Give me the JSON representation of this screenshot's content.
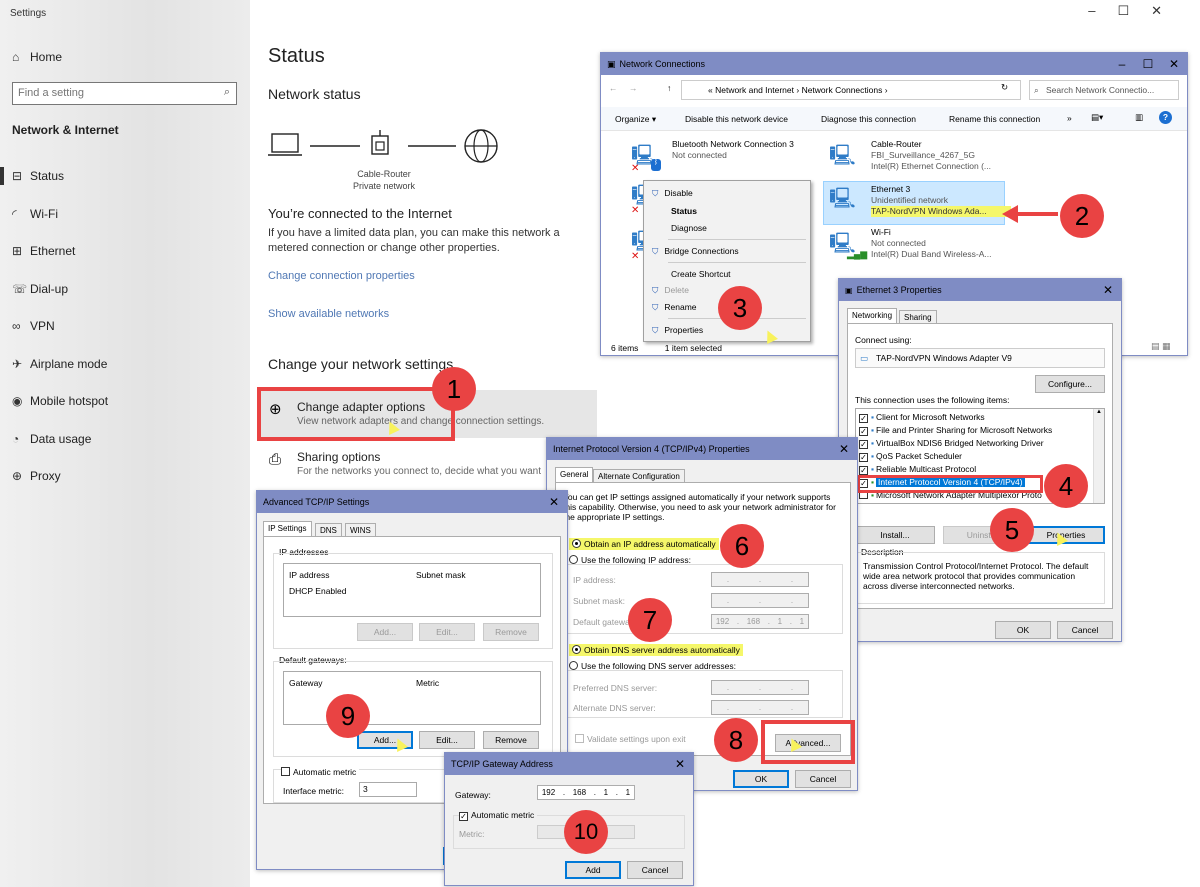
{
  "settings": {
    "window_title": "Settings",
    "home": "Home",
    "search_placeholder": "Find a setting",
    "section": "Network & Internet",
    "nav": [
      "Status",
      "Wi-Fi",
      "Ethernet",
      "Dial-up",
      "VPN",
      "Airplane mode",
      "Mobile hotspot",
      "Data usage",
      "Proxy"
    ],
    "status_title": "Status",
    "network_status": "Network status",
    "router_label": "Cable-Router",
    "network_label": "Private network",
    "connected_heading": "You’re connected to the Internet",
    "connected_text": "If you have a limited data plan, you can make this network a metered connection or change other properties.",
    "change_props_link": "Change connection properties",
    "show_networks_link": "Show available networks",
    "change_heading": "Change your network settings",
    "adapter_title": "Change adapter options",
    "adapter_desc": "View network adapters and change connection settings.",
    "sharing_title": "Sharing options",
    "sharing_desc": "For the networks you connect to, decide what you want"
  },
  "netconn": {
    "title": "Network Connections",
    "path": [
      "Network and Internet",
      "Network Connections"
    ],
    "search_placeholder": "Search Network Connectio...",
    "toolbar": [
      "Organize ▾",
      "Disable this network device",
      "Diagnose this connection",
      "Rename this connection",
      "»"
    ],
    "items": [
      {
        "name": "Bluetooth Network Connection 3",
        "line2": "Not connected",
        "line3": ""
      },
      {
        "name": "Cable-Router",
        "line2": "FBI_Surveillance_4267_5G",
        "line3": "Intel(R) Ethernet Connection (..."
      },
      {
        "name": "Ethernet 3",
        "line2": "Unidentified network",
        "line3": "TAP-NordVPN Windows Ada..."
      },
      {
        "name": "Wi-Fi",
        "line2": "Not connected",
        "line3": "Intel(R) Dual Band Wireless-A..."
      }
    ],
    "status_items": "6 items",
    "status_selected": "1 item selected"
  },
  "context_menu": [
    "Disable",
    "Status",
    "Diagnose",
    "Bridge Connections",
    "Create Shortcut",
    "Delete",
    "Rename",
    "Properties"
  ],
  "eth_props": {
    "title": "Ethernet 3 Properties",
    "tabs": [
      "Networking",
      "Sharing"
    ],
    "connect_using": "Connect using:",
    "adapter": "TAP-NordVPN Windows Adapter V9",
    "configure": "Configure...",
    "items_label": "This connection uses the following items:",
    "items": [
      "Client for Microsoft Networks",
      "File and Printer Sharing for Microsoft Networks",
      "VirtualBox NDIS6 Bridged Networking Driver",
      "QoS Packet Scheduler",
      "Reliable Multicast Protocol",
      "Internet Protocol Version 4 (TCP/IPv4)",
      "Microsoft Network Adapter Multiplexor Proto"
    ],
    "install": "Install...",
    "uninstall": "Uninstall",
    "properties": "Properties",
    "description_label": "Description",
    "description": "Transmission Control Protocol/Internet Protocol. The default wide area network protocol that provides communication across diverse interconnected networks.",
    "ok": "OK",
    "cancel": "Cancel"
  },
  "ipv4": {
    "title": "Internet Protocol Version 4 (TCP/IPv4) Properties",
    "tabs": [
      "General",
      "Alternate Configuration"
    ],
    "intro": "You can get IP settings assigned automatically if your network supports this capability. Otherwise, you need to ask your network administrator for the appropriate IP settings.",
    "auto_ip": "Obtain an IP address automatically",
    "manual_ip": "Use the following IP address:",
    "ip_label": "IP address:",
    "mask_label": "Subnet mask:",
    "gw_label": "Default gateway:",
    "gw_value": [
      "192",
      "168",
      "1",
      "1"
    ],
    "auto_dns": "Obtain DNS server address automatically",
    "manual_dns": "Use the following DNS server addresses:",
    "pref_dns": "Preferred DNS server:",
    "alt_dns": "Alternate DNS server:",
    "validate": "Validate settings upon exit",
    "advanced": "Advanced...",
    "ok": "OK",
    "cancel": "Cancel"
  },
  "adv": {
    "title": "Advanced TCP/IP Settings",
    "tabs": [
      "IP Settings",
      "DNS",
      "WINS"
    ],
    "ip_addresses": "IP addresses",
    "col_ip": "IP address",
    "col_mask": "Subnet mask",
    "dhcp": "DHCP Enabled",
    "add": "Add...",
    "edit": "Edit...",
    "remove": "Remove",
    "gateways": "Default gateways:",
    "col_gw": "Gateway",
    "col_metric": "Metric",
    "auto_metric": "Automatic metric",
    "iface_metric": "Interface metric:",
    "iface_value": "3"
  },
  "gwdlg": {
    "title": "TCP/IP Gateway Address",
    "gateway_label": "Gateway:",
    "gateway_value": [
      "192",
      "168",
      "1",
      "1"
    ],
    "auto_metric": "Automatic metric",
    "metric_label": "Metric:",
    "add": "Add",
    "cancel": "Cancel"
  },
  "badges": [
    "1",
    "2",
    "3",
    "4",
    "5",
    "6",
    "7",
    "8",
    "9",
    "10"
  ],
  "colors": {
    "badge": "#e94343",
    "titlebar": "#7f8cc4",
    "highlight": "#f5f76a",
    "link": "#5078b4"
  }
}
